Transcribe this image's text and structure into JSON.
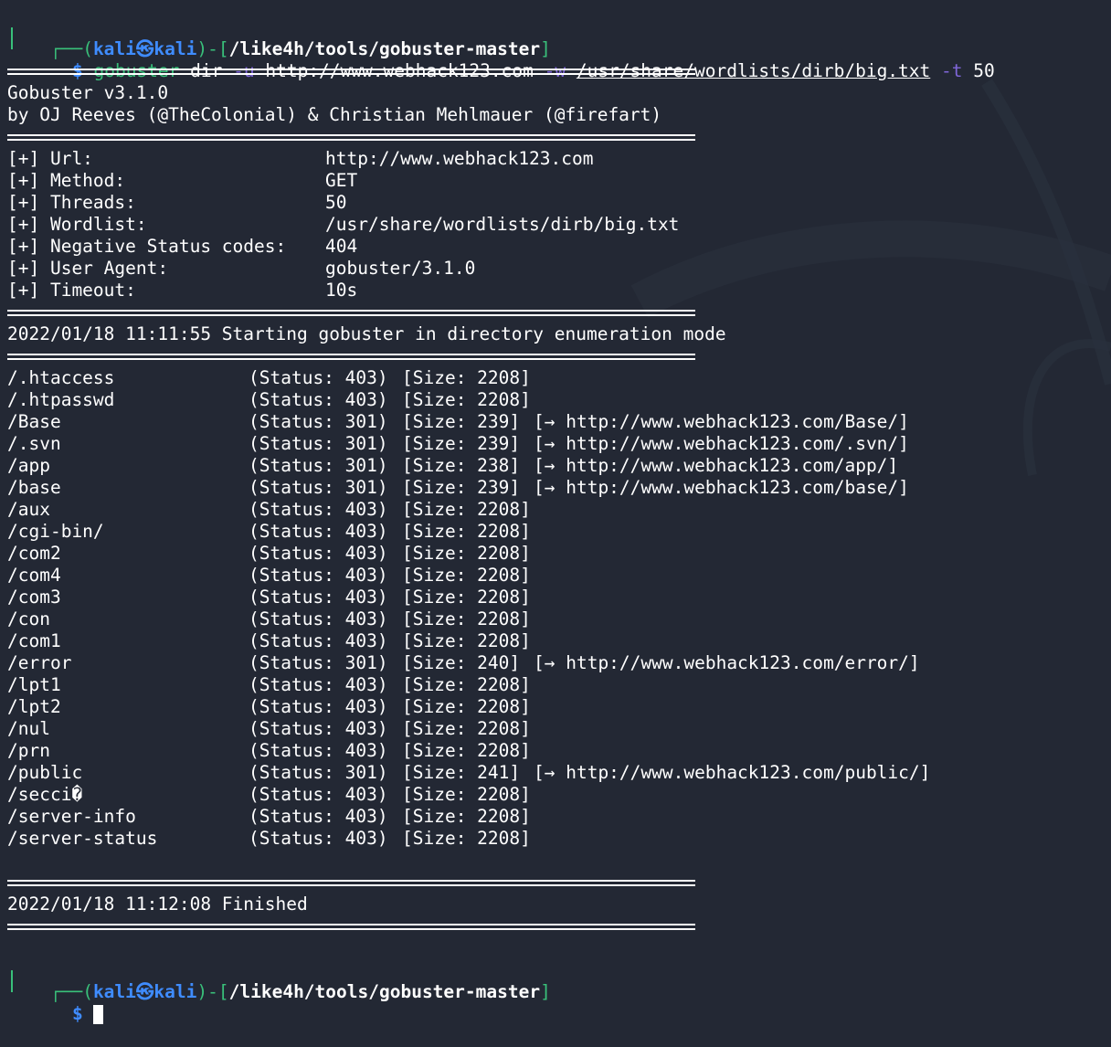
{
  "prompt": {
    "open": "┌──(",
    "user": "kali",
    "at": "㉿",
    "host": "kali",
    "mid": ")-[",
    "path": "/like4h/tools/gobuster-master",
    "close": "]",
    "dollar": "$"
  },
  "command": {
    "bin": "gobuster",
    "sub": "dir",
    "flag_u": "-u",
    "url": "http://www.webhack123.com",
    "flag_w": "-w",
    "wordlist": "/usr/share/wordlists/dirb/big.txt",
    "flag_t": "-t",
    "threads": "50"
  },
  "banner": {
    "version": "Gobuster v3.1.0",
    "authors": "by OJ Reeves (@TheColonial) & Christian Mehlmauer (@firefart)"
  },
  "config": [
    {
      "label": "[+] Url:",
      "value": "http://www.webhack123.com"
    },
    {
      "label": "[+] Method:",
      "value": "GET"
    },
    {
      "label": "[+] Threads:",
      "value": "50"
    },
    {
      "label": "[+] Wordlist:",
      "value": "/usr/share/wordlists/dirb/big.txt"
    },
    {
      "label": "[+] Negative Status codes:",
      "value": "404"
    },
    {
      "label": "[+] User Agent:",
      "value": "gobuster/3.1.0"
    },
    {
      "label": "[+] Timeout:",
      "value": "10s"
    }
  ],
  "start_msg": "2022/01/18 11:11:55 Starting gobuster in directory enumeration mode",
  "results": [
    {
      "path": "/.htaccess",
      "status": "(Status: 403)",
      "size": "[Size: 2208]",
      "redirect": ""
    },
    {
      "path": "/.htpasswd",
      "status": "(Status: 403)",
      "size": "[Size: 2208]",
      "redirect": ""
    },
    {
      "path": "/Base",
      "status": "(Status: 301)",
      "size": "[Size: 239]",
      "redirect": "[→ http://www.webhack123.com/Base/]"
    },
    {
      "path": "/.svn",
      "status": "(Status: 301)",
      "size": "[Size: 239]",
      "redirect": "[→ http://www.webhack123.com/.svn/]"
    },
    {
      "path": "/app",
      "status": "(Status: 301)",
      "size": "[Size: 238]",
      "redirect": "[→ http://www.webhack123.com/app/]"
    },
    {
      "path": "/base",
      "status": "(Status: 301)",
      "size": "[Size: 239]",
      "redirect": "[→ http://www.webhack123.com/base/]"
    },
    {
      "path": "/aux",
      "status": "(Status: 403)",
      "size": "[Size: 2208]",
      "redirect": ""
    },
    {
      "path": "/cgi-bin/",
      "status": "(Status: 403)",
      "size": "[Size: 2208]",
      "redirect": ""
    },
    {
      "path": "/com2",
      "status": "(Status: 403)",
      "size": "[Size: 2208]",
      "redirect": ""
    },
    {
      "path": "/com4",
      "status": "(Status: 403)",
      "size": "[Size: 2208]",
      "redirect": ""
    },
    {
      "path": "/com3",
      "status": "(Status: 403)",
      "size": "[Size: 2208]",
      "redirect": ""
    },
    {
      "path": "/con",
      "status": "(Status: 403)",
      "size": "[Size: 2208]",
      "redirect": ""
    },
    {
      "path": "/com1",
      "status": "(Status: 403)",
      "size": "[Size: 2208]",
      "redirect": ""
    },
    {
      "path": "/error",
      "status": "(Status: 301)",
      "size": "[Size: 240]",
      "redirect": "[→ http://www.webhack123.com/error/]"
    },
    {
      "path": "/lpt1",
      "status": "(Status: 403)",
      "size": "[Size: 2208]",
      "redirect": ""
    },
    {
      "path": "/lpt2",
      "status": "(Status: 403)",
      "size": "[Size: 2208]",
      "redirect": ""
    },
    {
      "path": "/nul",
      "status": "(Status: 403)",
      "size": "[Size: 2208]",
      "redirect": ""
    },
    {
      "path": "/prn",
      "status": "(Status: 403)",
      "size": "[Size: 2208]",
      "redirect": ""
    },
    {
      "path": "/public",
      "status": "(Status: 301)",
      "size": "[Size: 241]",
      "redirect": "[→ http://www.webhack123.com/public/]"
    },
    {
      "path": "/secci�",
      "status": "(Status: 403)",
      "size": "[Size: 2208]",
      "redirect": ""
    },
    {
      "path": "/server-info",
      "status": "(Status: 403)",
      "size": "[Size: 2208]",
      "redirect": ""
    },
    {
      "path": "/server-status",
      "status": "(Status: 403)",
      "size": "[Size: 2208]",
      "redirect": ""
    }
  ],
  "finish_msg": "2022/01/18 11:12:08 Finished",
  "colors": {
    "background": "#232834",
    "prompt_user": "#3f8cff",
    "prompt_frame": "#39c07a",
    "flag": "#7f66d9"
  }
}
